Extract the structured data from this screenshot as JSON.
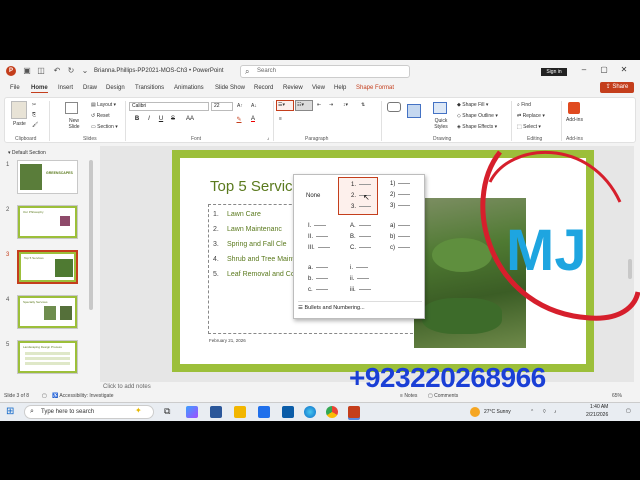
{
  "titlebar": {
    "filename": "Brianna.Phillips-PP2021-MOS-Ch3",
    "separator": "•",
    "app": "PowerPoint",
    "search_placeholder": "Search",
    "signin": "Sign in",
    "logo_letter": "P"
  },
  "menu_tabs": [
    "File",
    "Home",
    "Insert",
    "Draw",
    "Design",
    "Transitions",
    "Animations",
    "Slide Show",
    "Record",
    "Review",
    "View",
    "Help",
    "Shape Format"
  ],
  "share": "Share",
  "ribbon": {
    "clipboard": {
      "paste": "Paste",
      "label": "Clipboard"
    },
    "slides": {
      "new_slide": "New Slide",
      "layout": "Layout",
      "reset": "Reset",
      "section": "Section",
      "label": "Slides"
    },
    "font": {
      "name": "Calibri",
      "size": "22",
      "label": "Font",
      "bold": "B",
      "italic": "I",
      "underline": "U",
      "strike": "S",
      "aa": "AA",
      "color": "A"
    },
    "paragraph": {
      "label": "Paragraph"
    },
    "drawing": {
      "quick_styles": "Quick Styles",
      "shape_fill": "Shape Fill",
      "shape_outline": "Shape Outline",
      "shape_effects": "Shape Effects",
      "label": "Drawing"
    },
    "editing": {
      "find": "Find",
      "replace": "Replace",
      "select": "Select",
      "label": "Editing"
    },
    "addins": {
      "addins": "Add-ins",
      "label": "Add-ins"
    }
  },
  "thumbnails": {
    "section": "Default Section",
    "items": [
      {
        "num": "1",
        "title": "GREENSCAPES"
      },
      {
        "num": "2",
        "title": "Our Philosophy"
      },
      {
        "num": "3",
        "title": "Top 5 Services"
      },
      {
        "num": "4",
        "title": "Specialty Services"
      },
      {
        "num": "5",
        "title": "Landscaping Design Process"
      }
    ]
  },
  "slide": {
    "title": "Top 5 Servic",
    "bullets": [
      {
        "num": "1.",
        "text": "Lawn Care"
      },
      {
        "num": "2.",
        "text": "Lawn Maintenanc"
      },
      {
        "num": "3.",
        "text": "Spring and Fall Cle"
      },
      {
        "num": "4.",
        "text": "Shrub and Tree Maintenance"
      },
      {
        "num": "5.",
        "text": "Leaf Removal and Composting"
      }
    ],
    "date": "February 21, 2026"
  },
  "notes_placeholder": "Click to add notes",
  "bullet_menu": {
    "none": "None",
    "libraries": [
      [
        "1.",
        "2.",
        "3."
      ],
      [
        "1)",
        "2)",
        "3)"
      ],
      [
        "I.",
        "II.",
        "III."
      ],
      [
        "A.",
        "B.",
        "C."
      ],
      [
        "a)",
        "b)",
        "c)"
      ],
      [
        "a.",
        "b.",
        "c."
      ],
      [
        "i.",
        "ii.",
        "iii."
      ]
    ],
    "footer": "Bullets and Numbering..."
  },
  "statusbar": {
    "slide_info": "Slide 3 of 8",
    "accessibility": "Accessibility: Investigate",
    "notes": "Notes",
    "comments": "Comments",
    "zoom": "65%"
  },
  "taskbar": {
    "search": "Type here to search",
    "weather": "27°C  Sunny",
    "time": "1:40 AM",
    "date": "2/21/2026"
  },
  "watermark": {
    "letters": "MJ",
    "phone": "+923220268966"
  },
  "colors": {
    "accent": "#c43e1c",
    "slide_green": "#9cbf3a",
    "title_green": "#5b7a1e",
    "watermark_blue": "#1a3fd6"
  }
}
